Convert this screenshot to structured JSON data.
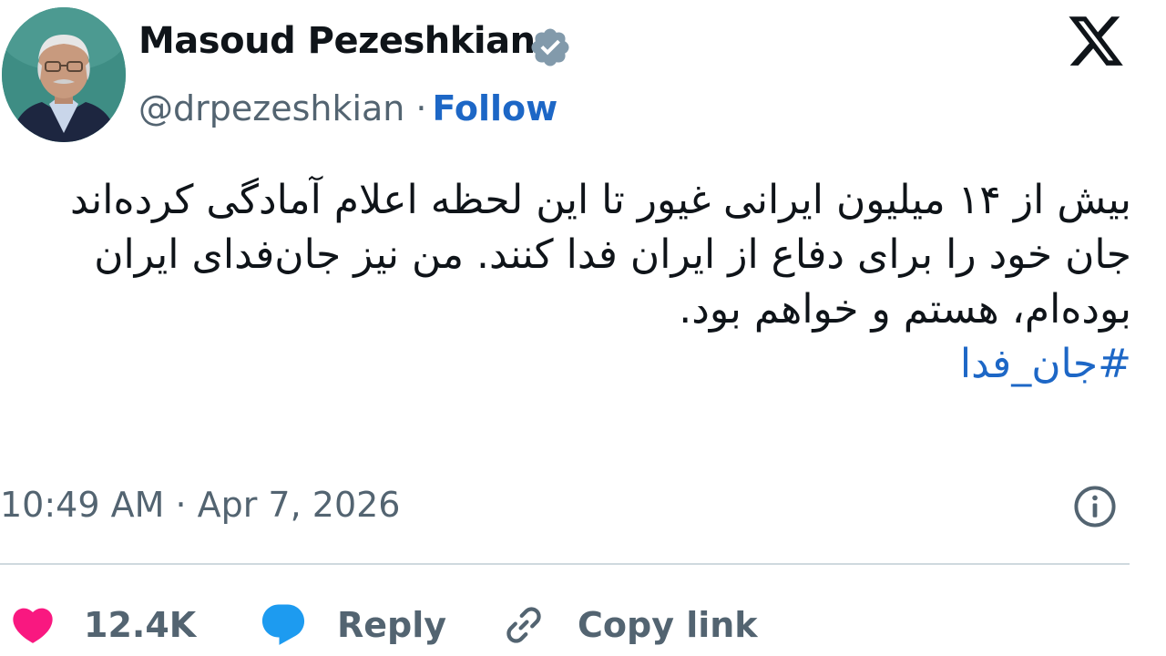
{
  "author": {
    "display_name": "Masoud Pezeshkian",
    "handle": "@drpezeshkian",
    "separator": "·",
    "follow_label": "Follow",
    "verified_color": "#829aab",
    "avatar_icon": "profile-photo"
  },
  "brand": {
    "logo_icon": "x-logo",
    "color": "#0f1419"
  },
  "tweet": {
    "lines": [
      "بیش از ۱۴ میلیون ایرانی غیور تا این لحظه اعلام آمادگی کرده‌اند",
      "جان خود را برای دفاع از ایران فدا کنند. من نیز جان‌فدای ایران",
      "بوده‌ام، هستم و خواهم بود."
    ],
    "hashtag": "#جان_فدا",
    "link_color": "#1d67c6"
  },
  "meta": {
    "timestamp": "10:49 AM · Apr 7, 2026",
    "info_icon": "info-icon"
  },
  "actions": {
    "like_count": "12.4K",
    "like_color": "#f91880",
    "reply_label": "Reply",
    "reply_color": "#1d9bf0",
    "copy_label": "Copy link"
  }
}
